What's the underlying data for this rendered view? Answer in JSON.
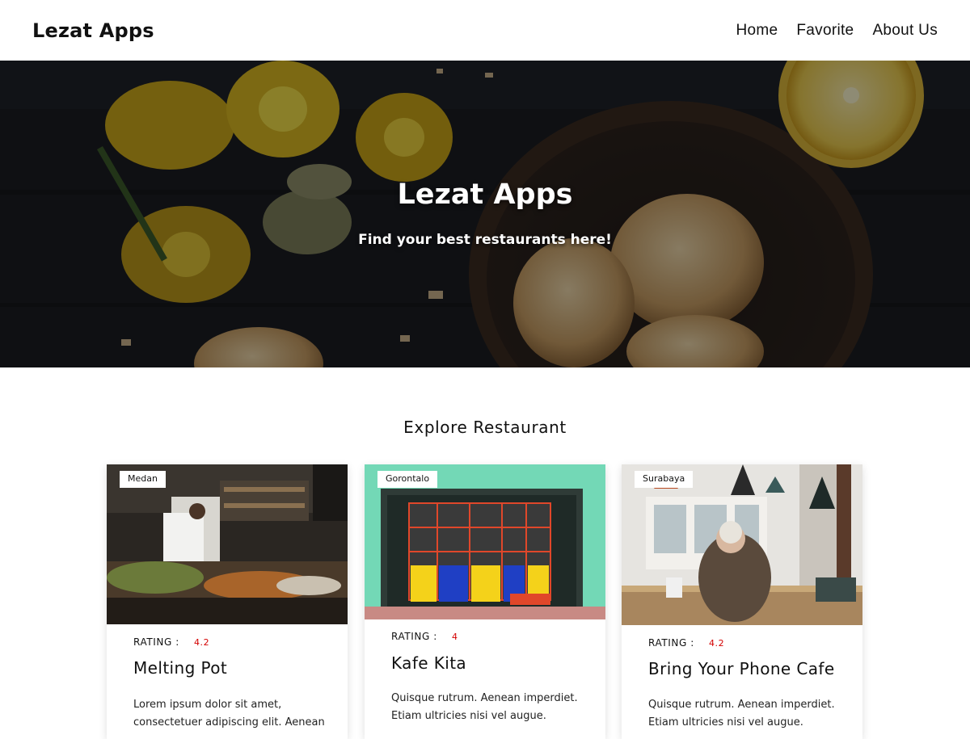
{
  "navbar": {
    "brand": "Lezat Apps",
    "links": [
      "Home",
      "Favorite",
      "About Us"
    ]
  },
  "hero": {
    "title": "Lezat Apps",
    "subtitle": "Find your best restaurants here!"
  },
  "section": {
    "title": "Explore Restaurant"
  },
  "restaurants": [
    {
      "city": "Medan",
      "rating_label": "RATING :",
      "rating": "4.2",
      "name": "Melting Pot",
      "description": "Lorem ipsum dolor sit amet, consectetuer adipiscing elit. Aenean"
    },
    {
      "city": "Gorontalo",
      "rating_label": "RATING :",
      "rating": "4",
      "name": "Kafe Kita",
      "description": "Quisque rutrum. Aenean imperdiet. Etiam ultricies nisi vel augue."
    },
    {
      "city": "Surabaya",
      "rating_label": "RATING :",
      "rating": "4.2",
      "name": "Bring Your Phone Cafe",
      "description": "Quisque rutrum. Aenean imperdiet. Etiam ultricies nisi vel augue."
    }
  ],
  "colors": {
    "rating": "#d40000",
    "hero_bg": "#171a1f",
    "text": "#111111"
  }
}
